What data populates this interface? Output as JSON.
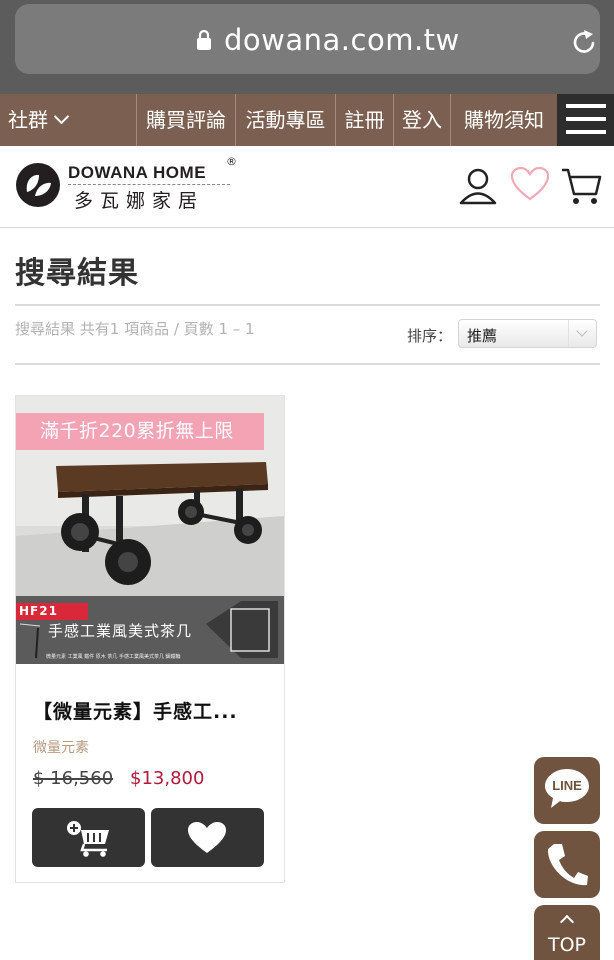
{
  "browser": {
    "url": "dowana.com.tw",
    "lock_icon": "lock-icon",
    "reload_icon": "reload-icon"
  },
  "nav": {
    "social_label": "社群",
    "items": [
      {
        "label": "購買評論"
      },
      {
        "label": "活動專區"
      },
      {
        "label": "註冊"
      },
      {
        "label": "登入"
      },
      {
        "label": "購物須知"
      }
    ],
    "menu_icon": "hamburger-menu-icon"
  },
  "header": {
    "logo_en": "DOWANA HOME",
    "logo_reg": "®",
    "logo_zh": "多瓦娜家居",
    "icons": [
      "account-icon",
      "wishlist-heart-icon",
      "cart-icon"
    ]
  },
  "page": {
    "title": "搜尋結果",
    "results_info": "搜尋結果 共有1 項商品 / 頁數 1 – 1",
    "sort_label": "排序：",
    "sort_value": "推薦"
  },
  "product": {
    "promo": "滿千折220累折無上限",
    "code": "HF21",
    "image_caption": "手感工業風美式茶几",
    "image_fine_print": "微量元素 工業風 鐵件 原木 茶几 手感工業風美式茶几 鑄鐵輪",
    "name": "【微量元素】手感工...",
    "brand": "微量元素",
    "price_old": "$ 16,560",
    "price_new": "$13,800",
    "add_cart_icon": "add-to-cart-icon",
    "wishlist_icon": "heart-icon"
  },
  "floating": {
    "line_label": "LINE",
    "phone_icon": "phone-icon",
    "top_label": "TOP"
  },
  "colors": {
    "nav_bg": "#7b6051",
    "floating_bg": "#70543f",
    "promo_pink": "#f4a3b5",
    "price_red": "#b3193a",
    "button_dark": "#333333"
  }
}
